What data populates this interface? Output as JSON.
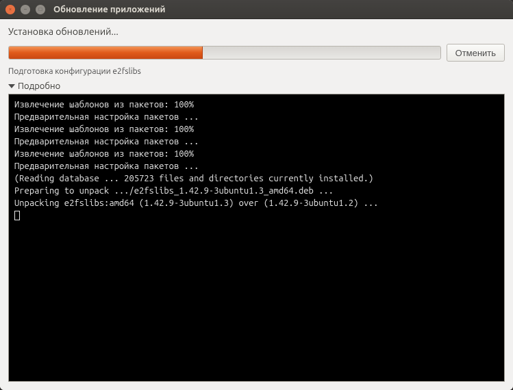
{
  "window": {
    "title": "Обновление приложений"
  },
  "heading": "Установка обновлений...",
  "progress": {
    "percent": 45
  },
  "cancel_label": "Отменить",
  "status_line": "Подготовка конфигурации e2fslibs",
  "disclosure_label": "Подробно",
  "terminal_lines": [
    "Извлечение шаблонов из пакетов: 100%",
    "Предварительная настройка пакетов ...",
    "Извлечение шаблонов из пакетов: 100%",
    "Предварительная настройка пакетов ...",
    "Извлечение шаблонов из пакетов: 100%",
    "Предварительная настройка пакетов ...",
    "(Reading database ... 205723 files and directories currently installed.)",
    "Preparing to unpack .../e2fslibs_1.42.9-3ubuntu1.3_amd64.deb ...",
    "Unpacking e2fslibs:amd64 (1.42.9-3ubuntu1.3) over (1.42.9-3ubuntu1.2) ..."
  ]
}
